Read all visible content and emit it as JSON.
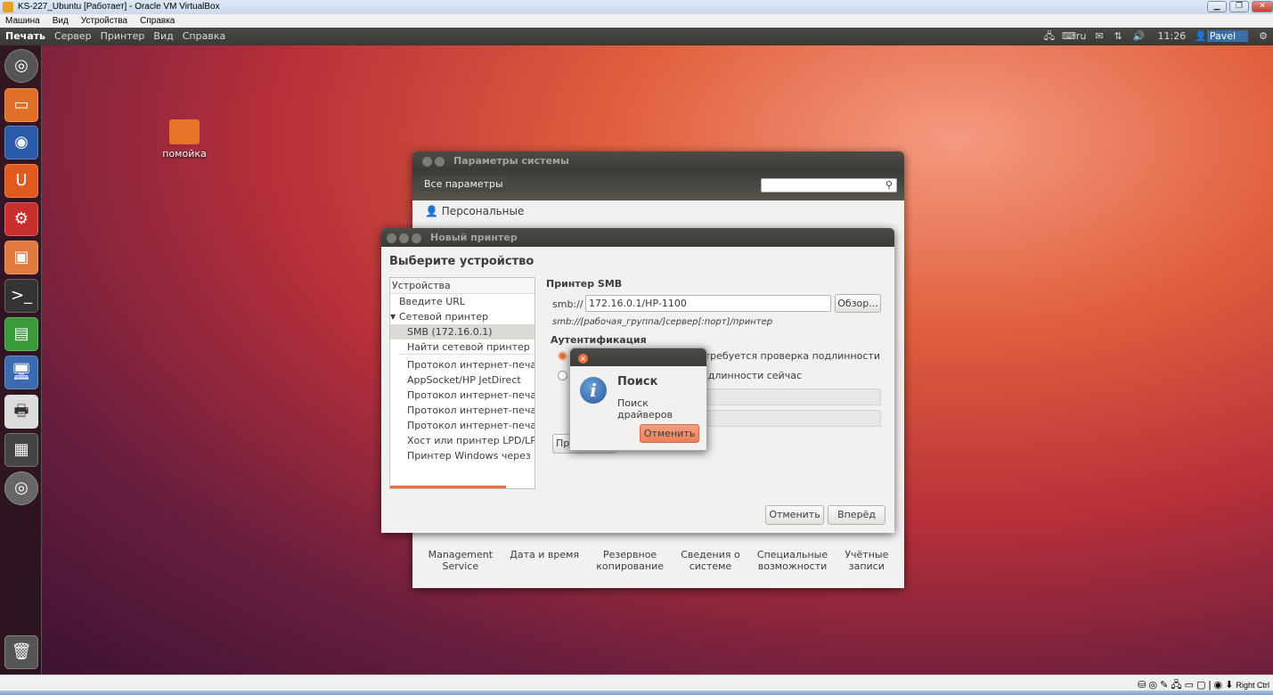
{
  "vbox": {
    "title": "KS-227_Ubuntu [Работает] - Oracle VM VirtualBox",
    "menu": [
      "Машина",
      "Вид",
      "Устройства",
      "Справка"
    ],
    "host_key": "Right Ctrl"
  },
  "panel": {
    "menu": [
      "Печать",
      "Сервер",
      "Принтер",
      "Вид",
      "Справка"
    ],
    "lang": "ru",
    "time": "11:26",
    "user": "Pavel"
  },
  "desktop": {
    "icon_label": "помойка"
  },
  "settings": {
    "title": "Параметры системы",
    "all_button": "Все параметры",
    "search_placeholder": "",
    "section": "Персональные",
    "items": [
      {
        "l1": "Management",
        "l2": "Service"
      },
      {
        "l1": "Дата и время",
        "l2": ""
      },
      {
        "l1": "Резервное",
        "l2": "копирование"
      },
      {
        "l1": "Сведения о",
        "l2": "системе"
      },
      {
        "l1": "Специальные",
        "l2": "возможности"
      },
      {
        "l1": "Учётные",
        "l2": "записи"
      }
    ]
  },
  "printer": {
    "title": "Новый принтер",
    "heading": "Выберите устройство",
    "list_header": "Устройства",
    "devices": [
      "Введите URL",
      "Сетевой принтер",
      "SMB (172.16.0.1)",
      "Найти сетевой принтер",
      "Протокол интернет-печати",
      "AppSocket/HP JetDirect",
      "Протокол интернет-печати",
      "Протокол интернет-печати",
      "Протокол интернет-печати",
      "Хост или принтер LPD/LPR",
      "Принтер Windows через SAMBA"
    ],
    "smb_title": "Принтер SMB",
    "smb_prefix": "smb://",
    "smb_value": "172.16.0.1/HP-1100",
    "browse": "Обзор...",
    "hint": "smb://[рабочая_группа/]сервер[:порт]/принтер",
    "auth": "Аутентификация",
    "radio1": "Запрашивать пользователя, если требуется проверка подлинности",
    "radio2": "Установить данные проверки подлинности сейчас",
    "verify_button": "Проверить...",
    "cancel": "Отменить",
    "forward": "Вперёд"
  },
  "search": {
    "title": "Поиск",
    "message": "Поиск драйверов",
    "cancel": "Отменить"
  }
}
